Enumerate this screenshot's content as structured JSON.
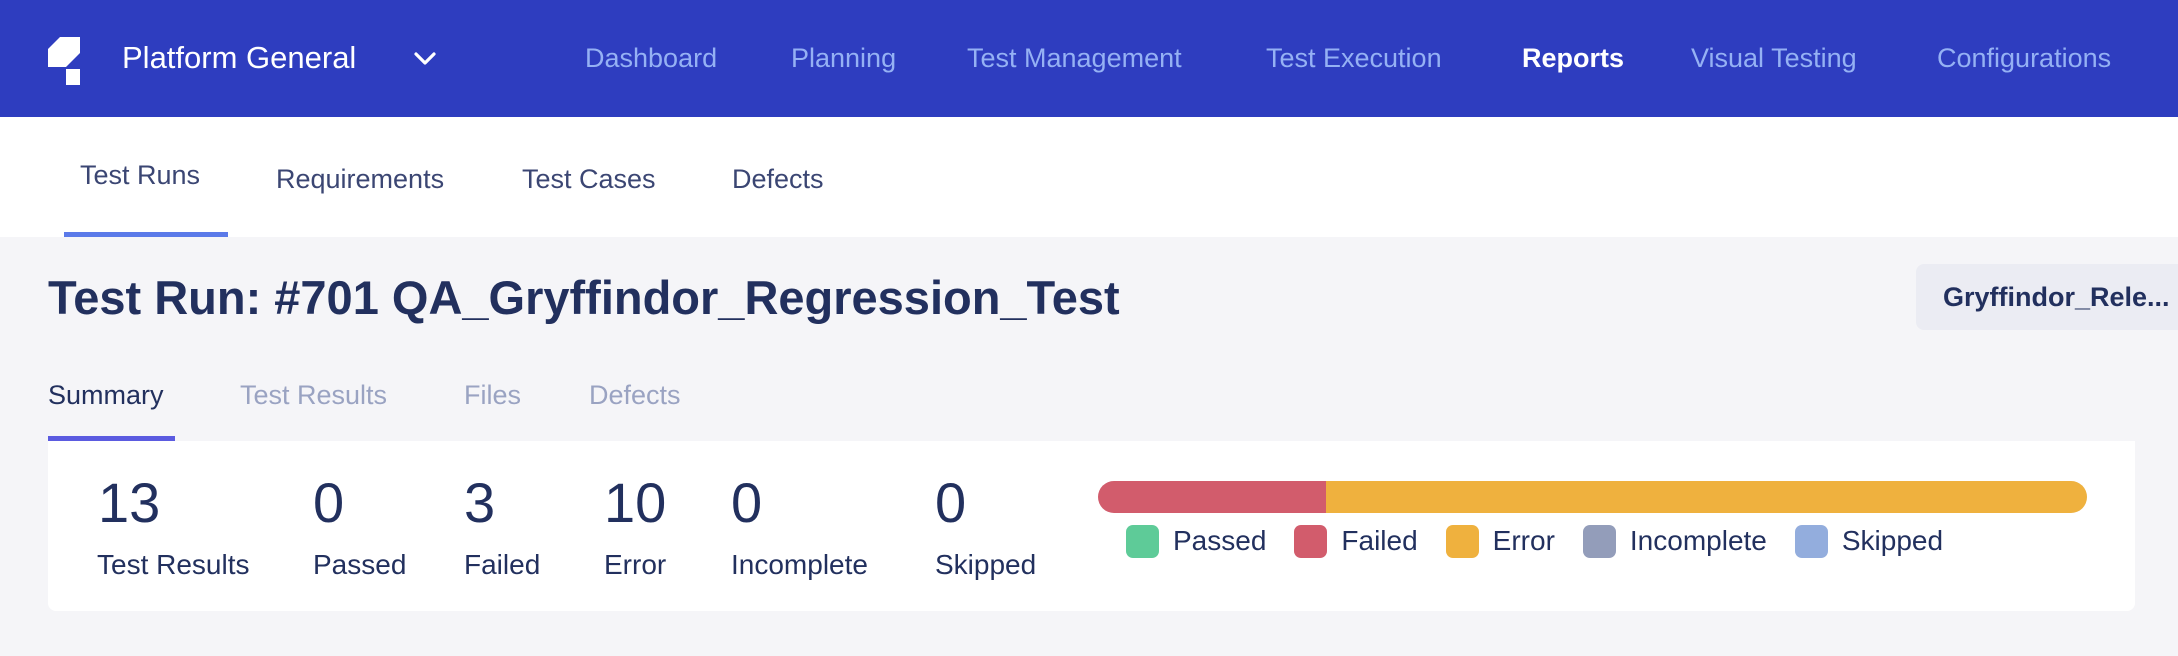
{
  "header": {
    "brand": "Platform General",
    "nav": [
      {
        "label": "Dashboard",
        "active": false
      },
      {
        "label": "Planning",
        "active": false
      },
      {
        "label": "Test Management",
        "active": false
      },
      {
        "label": "Test Execution",
        "active": false
      },
      {
        "label": "Reports",
        "active": true
      },
      {
        "label": "Visual Testing",
        "active": false
      },
      {
        "label": "Configurations",
        "active": false
      }
    ]
  },
  "subnav": [
    {
      "label": "Test Runs",
      "active": true
    },
    {
      "label": "Requirements",
      "active": false
    },
    {
      "label": "Test Cases",
      "active": false
    },
    {
      "label": "Defects",
      "active": false
    }
  ],
  "page": {
    "title": "Test Run: #701 QA_Gryffindor_Regression_Test",
    "release_chip": "Gryffindor_Rele..."
  },
  "tabs": [
    {
      "label": "Summary",
      "active": true
    },
    {
      "label": "Test Results",
      "active": false
    },
    {
      "label": "Files",
      "active": false
    },
    {
      "label": "Defects",
      "active": false
    }
  ],
  "summary": {
    "stats": [
      {
        "value": "13",
        "label": "Test Results"
      },
      {
        "value": "0",
        "label": "Passed"
      },
      {
        "value": "3",
        "label": "Failed"
      },
      {
        "value": "10",
        "label": "Error"
      },
      {
        "value": "0",
        "label": "Incomplete"
      },
      {
        "value": "0",
        "label": "Skipped"
      }
    ],
    "breakdown": [
      {
        "label": "Passed",
        "count": 0,
        "color": "#5ECB98"
      },
      {
        "label": "Failed",
        "count": 3,
        "color": "#D25C6C"
      },
      {
        "label": "Error",
        "count": 10,
        "color": "#EFB13E"
      },
      {
        "label": "Incomplete",
        "count": 0,
        "color": "#939DBA"
      },
      {
        "label": "Skipped",
        "count": 0,
        "color": "#93ADDD"
      }
    ]
  },
  "colors": {
    "header_bg": "#2E3DBF",
    "accent": "#5B7AE9",
    "text_dark": "#22305E"
  }
}
